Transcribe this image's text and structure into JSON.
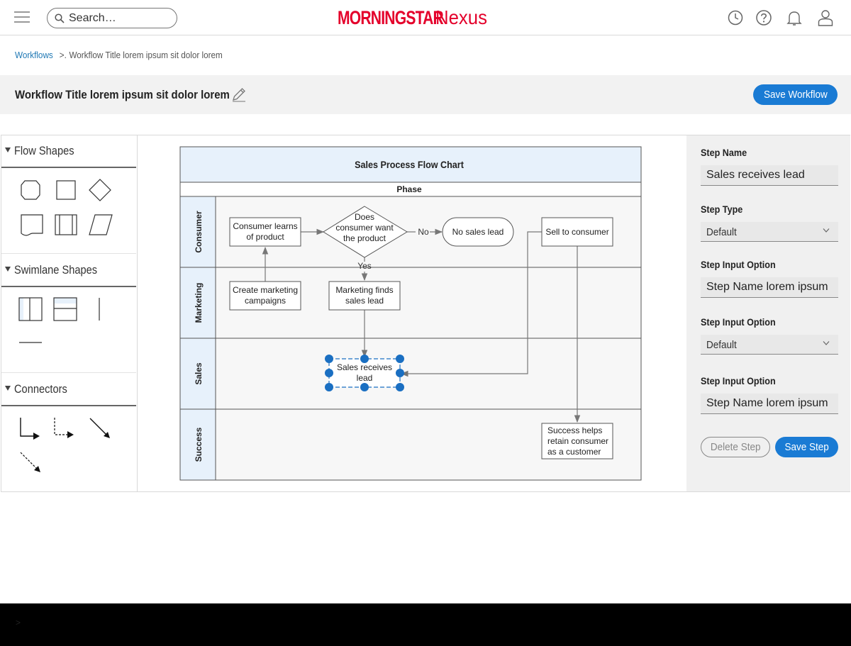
{
  "header": {
    "search_placeholder": "Search…",
    "brand_main": "MORNINGSTAR",
    "brand_sub": "Nexus",
    "brand_color": "#e4002b",
    "icons": [
      "menu-icon",
      "search-icon",
      "history-icon",
      "help-icon",
      "bell-icon",
      "user-icon"
    ]
  },
  "breadcrumb": {
    "root": "Workflows",
    "separator": ">.",
    "current": "Workflow Title lorem ipsum sit dolor lorem"
  },
  "titlebar": {
    "title": "Workflow Title lorem ipsum sit dolor lorem",
    "save_label": "Save Workflow"
  },
  "palette": {
    "sections": [
      {
        "label": "Flow Shapes",
        "shapes": [
          "terminator-shape",
          "process-shape",
          "decision-shape",
          "document-shape",
          "predefined-process-shape",
          "data-shape"
        ]
      },
      {
        "label": "Swimlane Shapes",
        "shapes": [
          "vertical-pool-shape",
          "horizontal-pool-shape",
          "vertical-separator-shape",
          "horizontal-separator-shape"
        ]
      },
      {
        "label": "Connectors",
        "shapes": [
          "elbow-connector",
          "dashed-elbow-connector",
          "straight-arrow-connector",
          "dashed-arrow-connector"
        ]
      }
    ]
  },
  "flowchart": {
    "title": "Sales Process Flow Chart",
    "phase_label": "Phase",
    "lanes": [
      "Consumer",
      "Marketing",
      "Sales",
      "Success"
    ],
    "nodes": {
      "learns": [
        "Consumer learns",
        "of product"
      ],
      "decision": [
        "Does",
        "consumer want",
        "the product"
      ],
      "no_sales": "No sales lead",
      "sell": "Sell to consumer",
      "campaign": [
        "Create marketing",
        "campaigns"
      ],
      "finds": [
        "Marketing finds",
        "sales lead"
      ],
      "receives": [
        "Sales receives",
        "lead"
      ],
      "success": [
        "Success helps",
        "retain consumer",
        "as a customer"
      ]
    },
    "edge_labels": {
      "no": "No",
      "yes": "Yes"
    },
    "header_fill": "#e7f1fb",
    "lane_fill": "#f7f7f7",
    "selection_color": "#1a6fc2"
  },
  "properties": {
    "step_name_label": "Step Name",
    "step_name_value": "Sales receives lead",
    "step_type_label": "Step Type",
    "step_type_value": "Default",
    "input_option_1_label": "Step Input Option",
    "input_option_1_value": "Step Name lorem ipsum",
    "input_option_2_label": "Step Input Option",
    "input_option_2_value": "Default",
    "input_option_3_label": "Step Input Option",
    "input_option_3_value": "Step Name lorem ipsum",
    "delete_label": "Delete Step",
    "save_label": "Save Step"
  },
  "footer": {
    "caret": ">"
  }
}
